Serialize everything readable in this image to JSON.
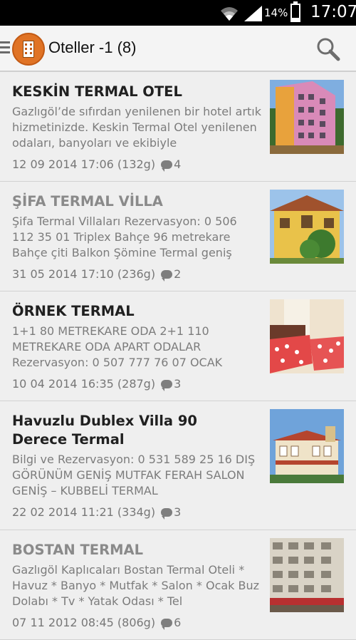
{
  "status_bar": {
    "battery_percent": "14%",
    "time": "17:07",
    "icons": [
      "wifi-icon",
      "signal-icon",
      "battery-icon"
    ]
  },
  "action_bar": {
    "title": "Oteller -1 (8)",
    "icons": [
      "drawer-icon",
      "hotel-icon",
      "search-icon"
    ],
    "accent": "#e07325"
  },
  "items": [
    {
      "title": "KESKİN TERMAL OTEL",
      "excerpt": "Gazlıgöl’de sıfırdan yenilenen bir hotel artık hizmetinizde. Keskin Termal Otel yenilenen odaları, banyoları ve ekibiyle",
      "date": "12 09 2014 17:06 (132g)",
      "comments": "4"
    },
    {
      "title": "ŞİFA TERMAL VİLLA",
      "excerpt": "Şifa Termal Villaları Rezervasyon: 0 506 112 35 01 Triplex Bahçe 96 metrekare Bahçe çiti Balkon Şömine Termal geniş",
      "date": "31 05 2014 17:10 (236g)",
      "comments": "2"
    },
    {
      "title": "ÖRNEK TERMAL",
      "excerpt": "1+1 80 METREKARE ODA 2+1 110 METREKARE ODA APART ODALAR Rezervasyon:  0 507 777 76 07 OCAK",
      "date": "10 04 2014 16:35 (287g)",
      "comments": "3"
    },
    {
      "title": "Havuzlu Dublex Villa 90 Derece Termal",
      "excerpt": "Bilgi ve Rezervasyon: 0 531 589 25 16 DIŞ GÖRÜNÜM GENİŞ MUTFAK FERAH SALON GENİŞ – KUBBELİ TERMAL",
      "date": "22 02 2014 11:21 (334g)",
      "comments": "3"
    },
    {
      "title": "BOSTAN TERMAL",
      "excerpt": "Gazlıgöl Kaplıcaları Bostan Termal Oteli * Havuz * Banyo * Mutfak * Salon * Ocak Buz Dolabı * Tv * Yatak Odası * Tel",
      "date": "07 11 2012 08:45 (806g)",
      "comments": "6"
    }
  ]
}
